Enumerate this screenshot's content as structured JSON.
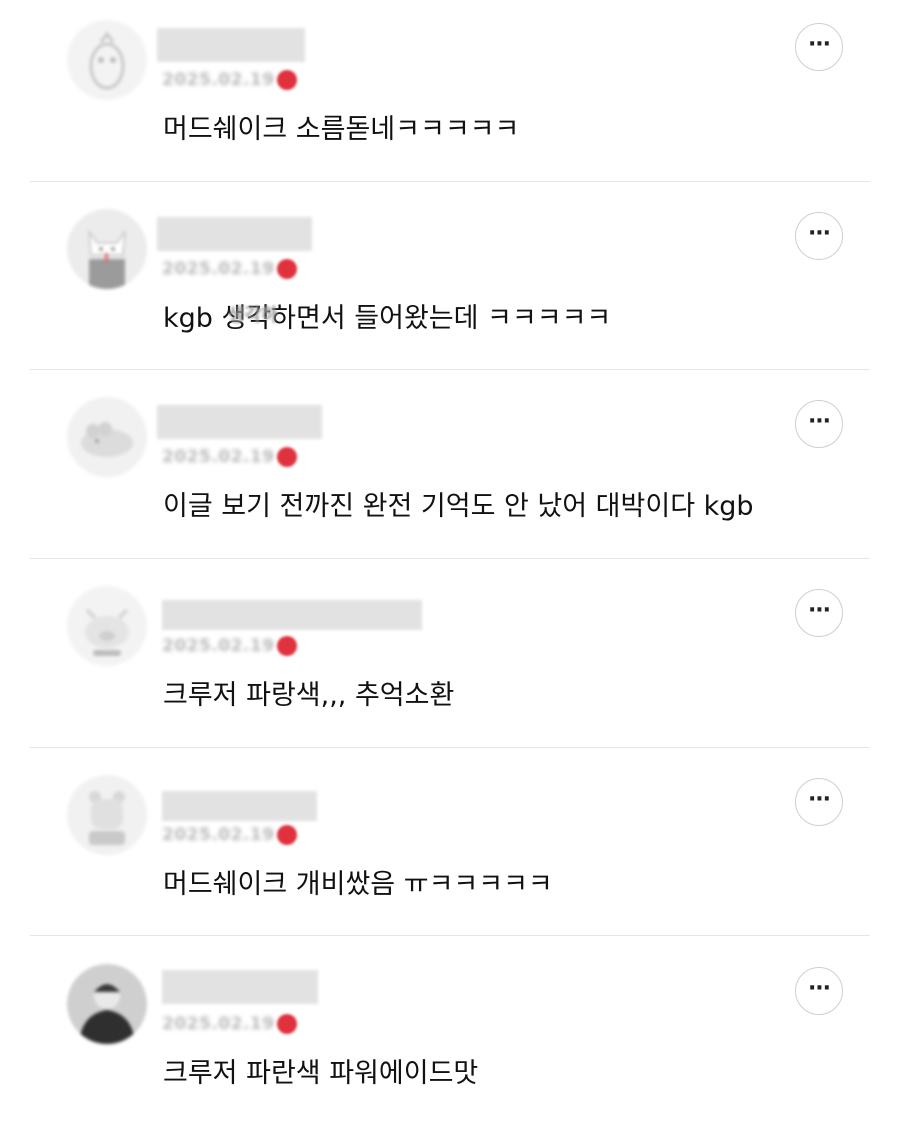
{
  "comments": [
    {
      "date": "2025.02.19",
      "text": "머드쉐이크 소름돋네ㅋㅋㅋㅋㅋ",
      "more_label": "···",
      "avatar_icon": "penguin-avatar-icon"
    },
    {
      "date": "2025.02.19",
      "text": "kgb 생각하면서 들어왔는데 ㅋㅋㅋㅋㅋ",
      "more_label": "···",
      "avatar_icon": "cat-avatar-icon"
    },
    {
      "date": "2025.02.19",
      "text": "이글 보기 전까진 완전 기억도 안 났어 대박이다 kgb",
      "more_label": "···",
      "avatar_icon": "mouse-avatar-icon"
    },
    {
      "date": "2025.02.19",
      "text": "크루저 파랑색,,, 추억소환",
      "more_label": "···",
      "avatar_icon": "pig-avatar-icon"
    },
    {
      "date": "2025.02.19",
      "text": "머드쉐이크 개비쌌음 ㅠㅋㅋㅋㅋㅋ",
      "more_label": "···",
      "avatar_icon": "bear-avatar-icon"
    },
    {
      "date": "2025.02.19",
      "text": "크루저 파란색 파워에이드맛",
      "more_label": "···",
      "avatar_icon": "person-avatar-icon"
    }
  ],
  "overlap_text": "생각하",
  "colors": {
    "new_dot": "#e0323e",
    "divider": "#e6e6e6",
    "text": "#111111"
  }
}
